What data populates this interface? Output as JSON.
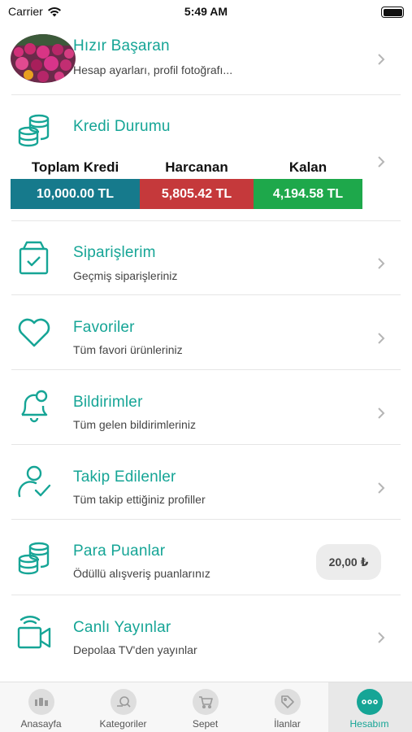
{
  "status_bar": {
    "carrier": "Carrier",
    "time": "5:49 AM"
  },
  "profile": {
    "name": "Hızır Başaran",
    "subtitle": "Hesap ayarları, profil fotoğrafı..."
  },
  "credit": {
    "title": "Kredi Durumu",
    "total_label": "Toplam Kredi",
    "total_value": "10,000.00 TL",
    "spent_label": "Harcanan",
    "spent_value": "5,805.42 TL",
    "remaining_label": "Kalan",
    "remaining_value": "4,194.58 TL",
    "colors": {
      "total": "#167a8c",
      "spent": "#c5393b",
      "remaining": "#1ea84b"
    }
  },
  "menu": [
    {
      "title": "Siparişlerim",
      "subtitle": "Geçmiş siparişleriniz",
      "icon": "box-icon"
    },
    {
      "title": "Favoriler",
      "subtitle": "Tüm favori ürünleriniz",
      "icon": "heart-icon"
    },
    {
      "title": "Bildirimler",
      "subtitle": "Tüm gelen bildirimleriniz",
      "icon": "bell-icon"
    },
    {
      "title": "Takip Edilenler",
      "subtitle": "Tüm takip ettiğiniz profiller",
      "icon": "user-check-icon"
    },
    {
      "title": "Para Puanlar",
      "subtitle": "Ödüllü alışveriş puanlarınız",
      "icon": "coins-icon",
      "badge": "20,00 ₺"
    },
    {
      "title": "Canlı Yayınlar",
      "subtitle": "Depolaa TV'den yayınlar",
      "icon": "video-camera-icon"
    }
  ],
  "tabs": [
    {
      "label": "Anasayfa",
      "icon": "home-icon"
    },
    {
      "label": "Kategoriler",
      "icon": "categories-icon"
    },
    {
      "label": "Sepet",
      "icon": "cart-icon"
    },
    {
      "label": "İlanlar",
      "icon": "tag-icon"
    },
    {
      "label": "Hesabım",
      "icon": "more-icon",
      "active": true
    }
  ],
  "accent_color": "#16a596"
}
